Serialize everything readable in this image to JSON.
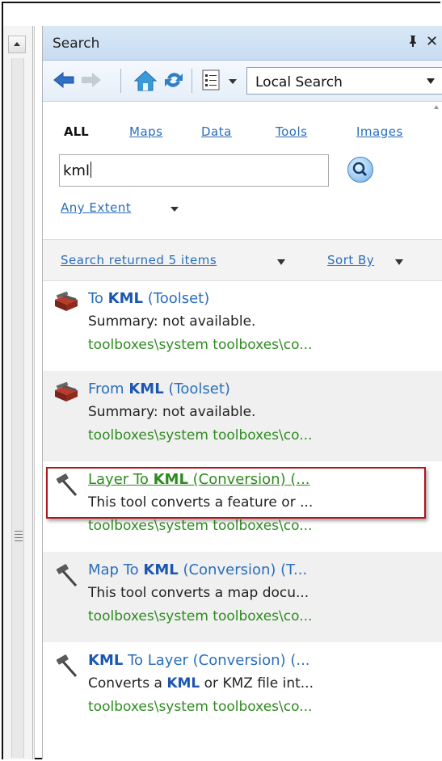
{
  "panel": {
    "title": "Search",
    "pin": "↑",
    "close": "✕"
  },
  "toolbar": {
    "local_search": "Local Search",
    "icons": [
      "back-arrow-icon",
      "forward-arrow-icon",
      "home-icon",
      "refresh-icon",
      "view-list-icon"
    ]
  },
  "categories": {
    "all": "ALL",
    "maps": "Maps",
    "data": "Data",
    "tools": "Tools",
    "images": "Images"
  },
  "search": {
    "query": "kml",
    "extent": "Any Extent"
  },
  "results_bar": {
    "count": "Search returned 5 items",
    "sort": "Sort By"
  },
  "results": [
    {
      "pre": "To ",
      "kw": "KML",
      "post": " (Toolset)",
      "summary": "Summary: not available.",
      "path": "toolboxes\\system toolboxes\\co...",
      "icon": "toolset-icon"
    },
    {
      "pre": "From ",
      "kw": "KML",
      "post": " (Toolset)",
      "summary": "Summary: not available.",
      "path": "toolboxes\\system toolboxes\\co...",
      "icon": "toolset-icon"
    },
    {
      "pre": "Layer To ",
      "kw": "KML",
      "post": " (Conversion) (...",
      "summary": "This tool converts a feature or ...",
      "path": "toolboxes\\system toolboxes\\co...",
      "icon": "hammer-icon"
    },
    {
      "pre": "Map To ",
      "kw": "KML",
      "post": " (Conversion) (T...",
      "summary": "This tool converts a map docu...",
      "path": "toolboxes\\system toolboxes\\co...",
      "icon": "hammer-icon"
    },
    {
      "pre": "",
      "kw": "KML",
      "post": " To Layer (Conversion) (...",
      "summary_pre": "Converts a ",
      "summary_kw": "KML",
      "summary_post": " or KMZ file int...",
      "path": "toolboxes\\system toolboxes\\co...",
      "icon": "hammer-icon"
    }
  ],
  "colors": {
    "link": "#2a6ebb",
    "keyword": "#1c56b0",
    "path": "#2e8b20",
    "highlight_border": "#b3151a",
    "title_bg": "#d2e4f6"
  }
}
